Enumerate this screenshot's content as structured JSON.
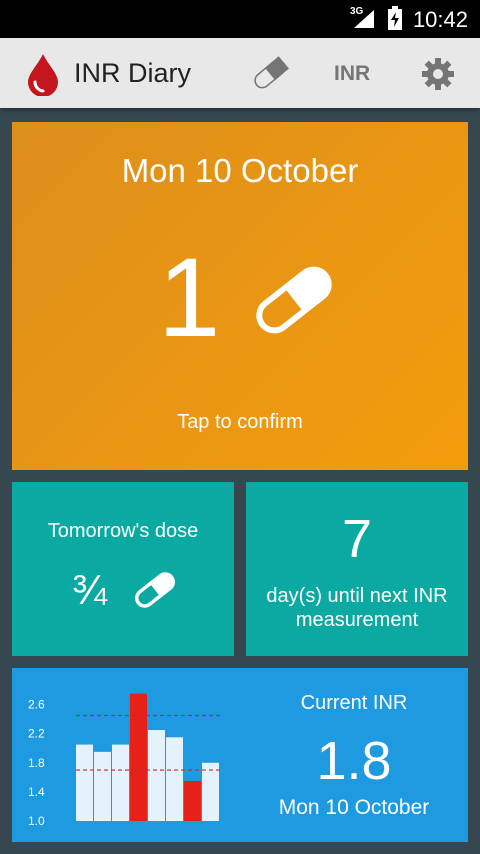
{
  "status_bar": {
    "network": "3G",
    "time": "10:42"
  },
  "app_bar": {
    "title": "INR Diary",
    "inr_action": "INR",
    "icons": [
      "blood-drop-icon",
      "pill-icon",
      "gear-icon"
    ]
  },
  "today": {
    "date": "Mon 10 October",
    "dose": "1",
    "hint": "Tap to confirm",
    "color": "#e8931a"
  },
  "tomorrow": {
    "label": "Tomorrow's dose",
    "dose": "¾",
    "color": "#0aa9a1"
  },
  "next_inr": {
    "days": "7",
    "label": "day(s) until next INR measurement"
  },
  "inr_summary": {
    "label": "Current INR",
    "value": "1.8",
    "date": "Mon 10 October",
    "color": "#1e9be0"
  },
  "chart_data": {
    "type": "bar",
    "categories": [
      "",
      "",
      "",
      "",
      "",
      "",
      "",
      ""
    ],
    "values": [
      2.05,
      1.95,
      2.05,
      2.75,
      2.25,
      2.15,
      1.55,
      1.8
    ],
    "out_of_range": [
      false,
      false,
      false,
      true,
      false,
      false,
      true,
      false
    ],
    "target_range": [
      1.7,
      2.45
    ],
    "yticks": [
      "2.6",
      "2.2",
      "1.8",
      "1.4",
      "1.0"
    ],
    "ylim": [
      1.0,
      2.8
    ],
    "bar_color": "#e3f2fd",
    "alert_color": "#e62117",
    "range_line_color": "#c62828"
  }
}
